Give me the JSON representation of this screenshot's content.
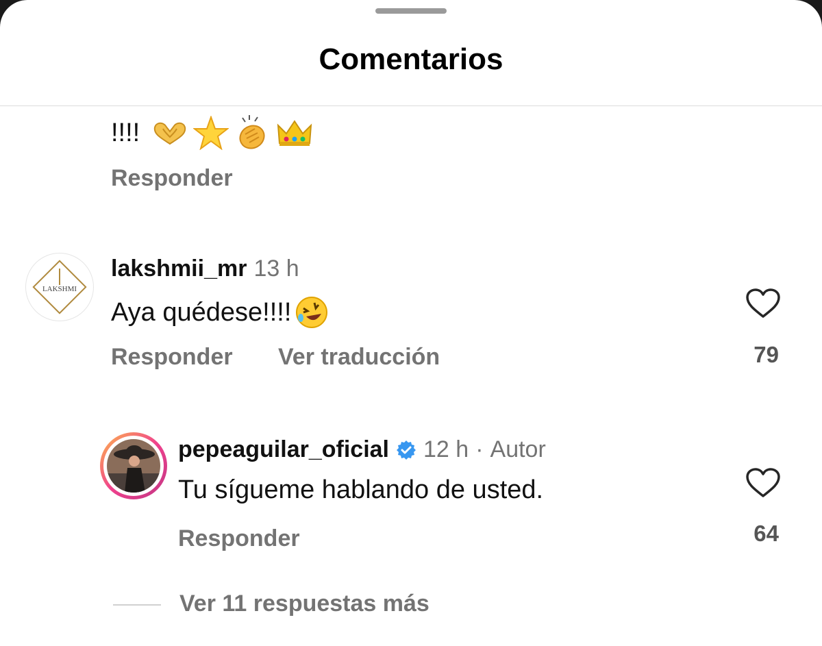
{
  "sheet": {
    "title": "Comentarios"
  },
  "top_comment": {
    "text": "!!!!",
    "reply_label": "Responder"
  },
  "comments": [
    {
      "username": "lakshmii_mr",
      "time": "13 h",
      "text": "Aya quédese!!!!",
      "reply_label": "Responder",
      "translate_label": "Ver traducción",
      "likes": "79",
      "avatar_text": "LAKSHMI"
    },
    {
      "username": "pepeaguilar_oficial",
      "time": "12 h",
      "separator": "·",
      "author_label": "Autor",
      "text": "Tu sígueme hablando de usted.",
      "reply_label": "Responder",
      "likes": "64"
    }
  ],
  "view_more": "Ver 11 respuestas más",
  "icons": {
    "heart": "heart-outline-icon",
    "verified": "verified-badge-icon"
  },
  "colors": {
    "secondary_text": "#737373",
    "verified_blue": "#3897f0"
  }
}
